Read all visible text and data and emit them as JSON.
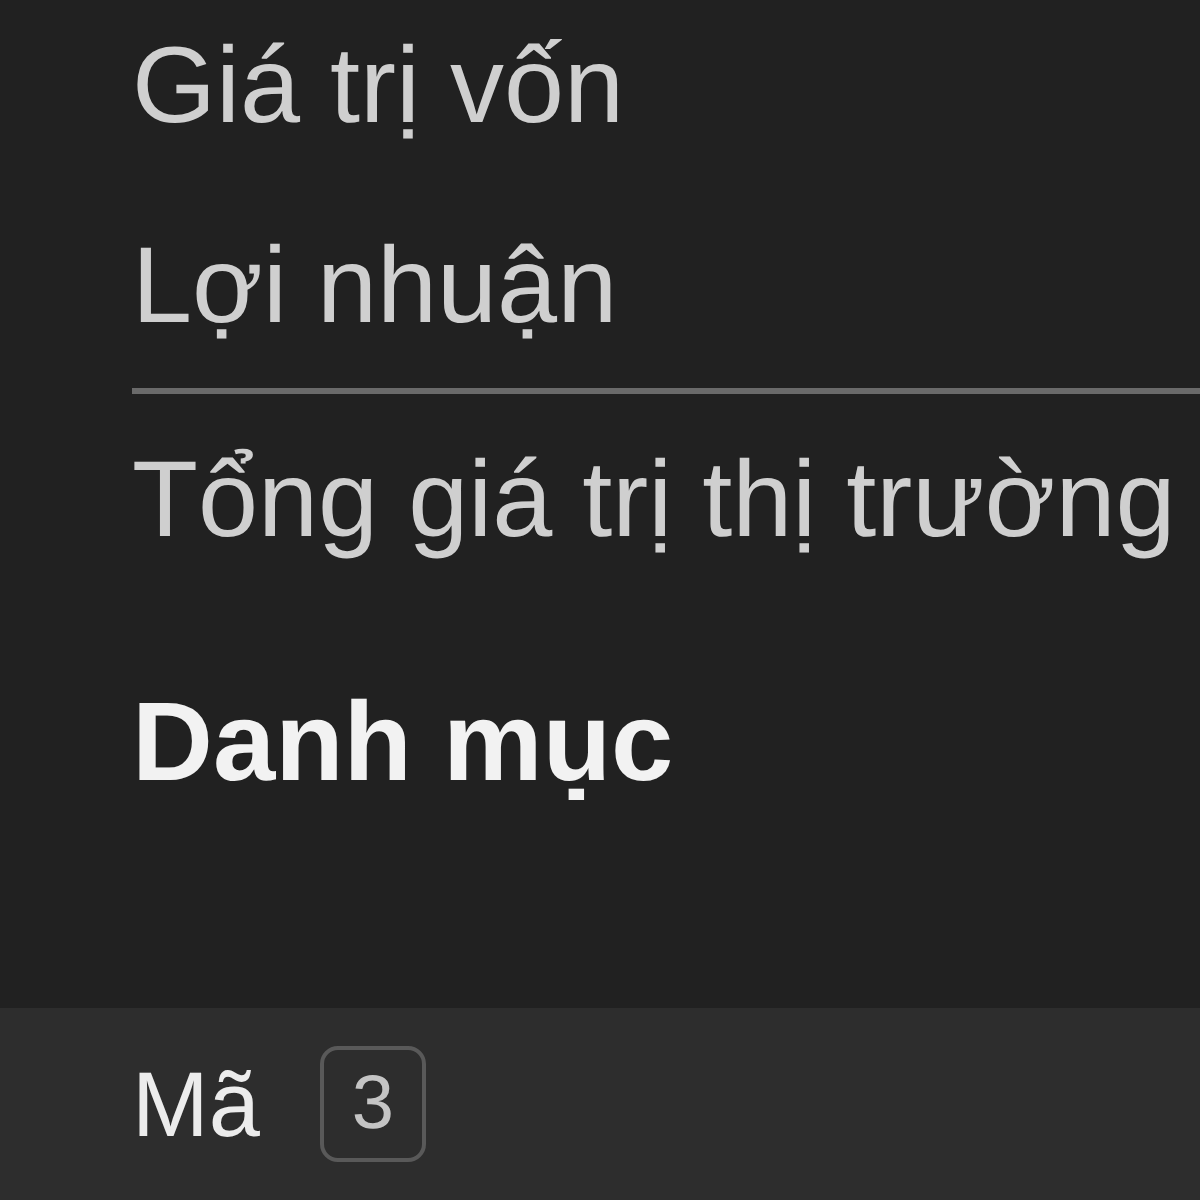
{
  "summary": {
    "rows": [
      {
        "label": "Giá trị vốn"
      },
      {
        "label": "Lợi nhuận"
      }
    ],
    "total": {
      "label": "Tổng giá trị thị trường"
    }
  },
  "section": {
    "title": "Danh mục"
  },
  "table": {
    "columns": [
      {
        "label": "Mã",
        "count": "3"
      }
    ]
  }
}
